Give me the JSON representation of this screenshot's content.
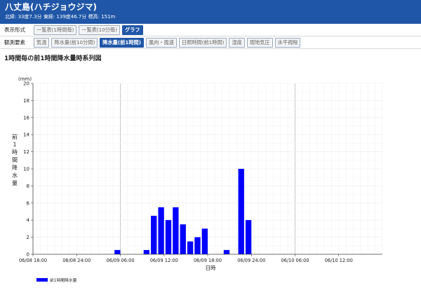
{
  "header": {
    "station": "八丈島(ハチジョウジマ)",
    "coords": "北緯: 33度7.3分 東経: 139度46.7分 標高: 151m"
  },
  "display_row": {
    "label": "表示形式",
    "buttons": [
      {
        "label": "一覧表(1時間毎)",
        "active": false
      },
      {
        "label": "一覧表(10分毎)",
        "active": false
      },
      {
        "label": "グラフ",
        "active": true
      }
    ]
  },
  "element_row": {
    "label": "観測要素",
    "buttons": [
      {
        "label": "気温",
        "active": false
      },
      {
        "label": "降水量(前10分間)",
        "active": false
      },
      {
        "label": "降水量(前1時間)",
        "active": true
      },
      {
        "label": "風向・風速",
        "active": false
      },
      {
        "label": "日照時間(前1時間)",
        "active": false
      },
      {
        "label": "湿度",
        "active": false
      },
      {
        "label": "現地気圧",
        "active": false
      },
      {
        "label": "水平視程",
        "active": false
      }
    ]
  },
  "chart_title": "1時間毎の前1時間降水量時系列図",
  "colors": {
    "bar": "#0000ff",
    "header": "#1f56a7"
  },
  "chart_data": {
    "type": "bar",
    "ylabel": "前1時間降水量",
    "yunit": "(mm)",
    "xlabel": "日時",
    "ylim": [
      0,
      20
    ],
    "y_ticks": [
      0,
      2,
      4,
      6,
      8,
      10,
      12,
      14,
      16,
      18,
      20
    ],
    "x_ticks": [
      "06/08 18:00",
      "06/08 24:00",
      "06/09 06:00",
      "06/09 12:00",
      "06/09 18:00",
      "06/09 24:00",
      "06/10 06:00",
      "06/10 12:00"
    ],
    "x_range_hours": [
      12,
      60
    ],
    "grid": true,
    "legend": "bottom-left",
    "series": [
      {
        "name": "前1時間降水量",
        "points": [
          {
            "hour": 24,
            "value": 0.5
          },
          {
            "hour": 28,
            "value": 0.5
          },
          {
            "hour": 29,
            "value": 4.5
          },
          {
            "hour": 30,
            "value": 5.5
          },
          {
            "hour": 31,
            "value": 4.0
          },
          {
            "hour": 32,
            "value": 5.5
          },
          {
            "hour": 33,
            "value": 3.5
          },
          {
            "hour": 34,
            "value": 1.5
          },
          {
            "hour": 35,
            "value": 2.0
          },
          {
            "hour": 36,
            "value": 3.0
          },
          {
            "hour": 39,
            "value": 0.5
          },
          {
            "hour": 41,
            "value": 10.0
          },
          {
            "hour": 42,
            "value": 4.0
          }
        ]
      }
    ]
  }
}
